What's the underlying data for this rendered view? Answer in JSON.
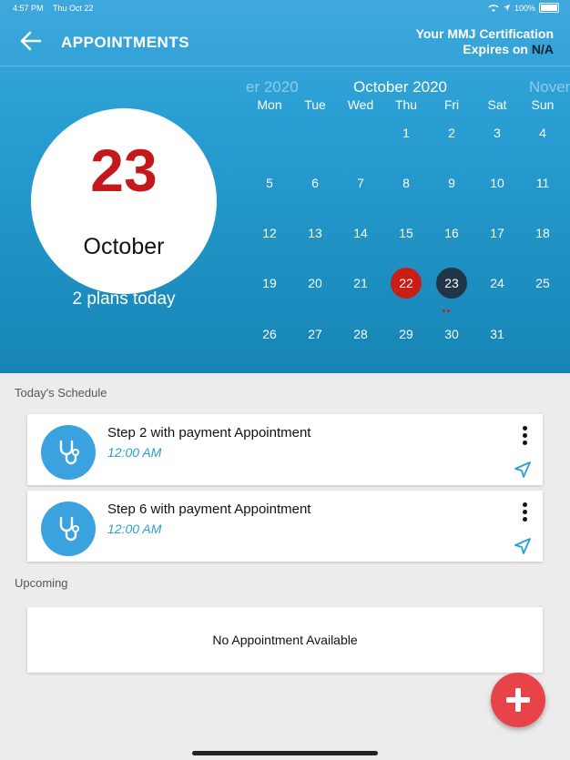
{
  "status_bar": {
    "time": "4:57 PM",
    "date": "Thu Oct 22",
    "battery": "100%"
  },
  "header": {
    "title": "APPOINTMENTS",
    "cert_line1": "Your MMJ Certification",
    "cert_line2_prefix": "Expires on ",
    "cert_value": "N/A"
  },
  "selected_date": {
    "day": "23",
    "month": "October",
    "plans": "2 plans today"
  },
  "calendar": {
    "prev_month": "er 2020",
    "current_month": "October 2020",
    "next_month": "Novemb",
    "weekdays": [
      "Mon",
      "Tue",
      "Wed",
      "Thu",
      "Fri",
      "Sat",
      "Sun"
    ],
    "days": [
      "1",
      "2",
      "3",
      "4",
      "5",
      "6",
      "7",
      "8",
      "9",
      "10",
      "11",
      "12",
      "13",
      "14",
      "15",
      "16",
      "17",
      "18",
      "19",
      "20",
      "21",
      "22",
      "23",
      "24",
      "25",
      "26",
      "27",
      "28",
      "29",
      "30",
      "31"
    ],
    "today": "22",
    "selected": "23",
    "colors": {
      "today": "#c81e16",
      "selected": "#223448"
    }
  },
  "schedule": {
    "label": "Today's Schedule",
    "items": [
      {
        "name": "Step 2 with payment Appointment",
        "time": "12:00 AM",
        "icon": "stethoscope-icon"
      },
      {
        "name": "Step 6 with payment Appointment",
        "time": "12:00 AM",
        "icon": "stethoscope-icon"
      }
    ]
  },
  "upcoming": {
    "label": "Upcoming",
    "empty_text": "No Appointment Available"
  },
  "colors": {
    "accent": "#2a9fd4",
    "fab": "#e9434a",
    "day_red": "#c4191a"
  }
}
